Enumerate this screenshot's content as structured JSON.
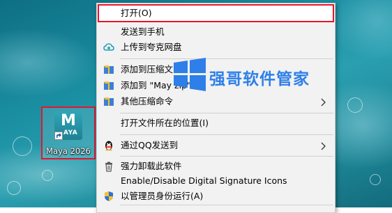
{
  "desktop": {
    "icon_label": "Maya 2026",
    "icon_logo_letter": "M",
    "icon_logo_sub": "AYA"
  },
  "menu": {
    "items": [
      {
        "label": "打开(O)",
        "icon": "none"
      },
      {
        "label": "发送到手机",
        "icon": "none"
      },
      {
        "label": "上传到夸克网盘",
        "icon": "quark-cloud-icon"
      },
      {
        "label": "添加到压缩文",
        "icon": "archive-icon"
      },
      {
        "label": "添加到 \"May       zip\" (T)",
        "icon": "archive-icon"
      },
      {
        "label": "其他压缩命令",
        "icon": "archive-icon",
        "submenu": true
      },
      {
        "label": "打开文件所在的位置(I)",
        "icon": "none"
      },
      {
        "label": "通过QQ发送到",
        "icon": "qq-penguin-icon",
        "submenu": true
      },
      {
        "label": "强力卸载此软件",
        "icon": "uninstall-icon"
      },
      {
        "label": "Enable/Disable Digital Signature Icons",
        "icon": "none"
      },
      {
        "label": "以管理员身份运行(A)",
        "icon": "shield-icon"
      }
    ]
  },
  "watermark": {
    "text": "强哥软件管家"
  },
  "colors": {
    "highlight_border": "#e8142b",
    "watermark": "#2e7fe8",
    "menu_bg": "#f2f2f2"
  }
}
